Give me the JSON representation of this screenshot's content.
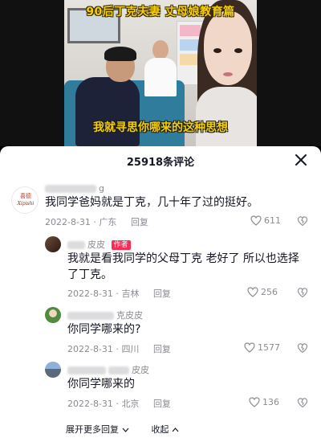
{
  "video": {
    "title": "90后丁克夫妻  丈母娘教育篇",
    "subtitle": "我就寻思你哪来的这种思想"
  },
  "comments_panel": {
    "title": "25918条评论"
  },
  "comments": [
    {
      "name_visible": "g",
      "avatar_text": "Xipishi",
      "text": "我同学爸妈就是丁克，几十年了过的挺好。",
      "date": "2022-8-31",
      "location": "广东",
      "reply_label": "回复",
      "likes": "611"
    },
    {
      "name_visible": "皮皮",
      "badge": "作者",
      "text_line1": "我就是看我同学的父母丁克 老好了 所以也选择",
      "text_line2": "了丁克。",
      "date": "2022-8-31",
      "location": "吉林",
      "reply_label": "回复",
      "likes": "256"
    },
    {
      "name_visible": "克皮皮",
      "text": "你同学哪来的?",
      "date": "2022-8-31",
      "location": "四川",
      "reply_label": "回复",
      "likes": "1577"
    },
    {
      "name_visible": "皮皮",
      "text": "你同学哪来的",
      "date": "2022-8-31",
      "location": "北京",
      "reply_label": "回复",
      "likes": "136"
    }
  ],
  "footer": {
    "expand_label": "展开更多回复",
    "collapse_label": "收起"
  },
  "colors": {
    "badge": "#fe2c55",
    "subtitle_yellow": "#f5d000",
    "meta_gray": "#8a8b91"
  }
}
